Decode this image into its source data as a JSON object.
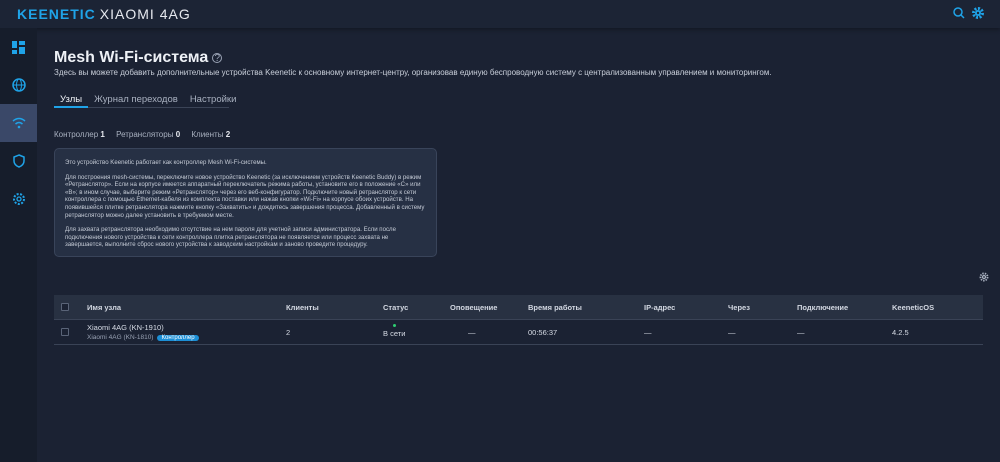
{
  "header": {
    "brand": "KEENETIC",
    "model": "XIAOMI 4AG"
  },
  "page": {
    "title": "Mesh Wi-Fi-система",
    "description": "Здесь вы можете добавить дополнительные устройства Keenetic к основному интернет-центру, организовав единую беспроводную систему с централизованным управлением и мониторингом.",
    "tabs": [
      {
        "label": "Узлы"
      },
      {
        "label": "Журнал переходов"
      },
      {
        "label": "Настройки"
      }
    ],
    "counters": [
      {
        "label": "Контроллер",
        "value": "1"
      },
      {
        "label": "Ретрансляторы",
        "value": "0"
      },
      {
        "label": "Клиенты",
        "value": "2"
      }
    ],
    "info": [
      "Это устройство Keenetic работает как контроллер Mesh Wi-Fi-системы.",
      "Для построения mesh-системы, переключите новое устройство Keenetic (за исключением устройств Keenetic Buddy) в режим «Ретранслятор». Если на корпусе имеется аппаратный переключатель режима работы, установите его в положение «C» или «B»; в ином случае, выберите режим «Ретранслятор» через его веб-конфигуратор. Подключите новый ретранслятор к сети контроллера с помощью Ethernet-кабеля из комплекта поставки или нажав кнопки «Wi-Fi» на корпусе обоих устройств. На появившейся плитке ретранслятора нажмите кнопку «Захватить» и дождитесь завершения процесса. Добавленный в систему ретранслятор можно далее установить в требуемом месте.",
      "Для захвата ретранслятора необходимо отсутствие на нем пароля для учетной записи администратора. Если после подключения нового устройства к сети контроллера плитка ретранслятора не появляется или процесс захвата не завершается, выполните сброс нового устройства к заводским настройкам и заново проведите процедуру."
    ]
  },
  "table": {
    "columns": [
      "Имя узла",
      "Клиенты",
      "Статус",
      "Оповещение",
      "Время работы",
      "IP-адрес",
      "Через",
      "Подключение",
      "KeeneticOS"
    ],
    "rows": [
      {
        "name": "Xiaomi 4AG (KN-1910)",
        "model": "Xiaomi 4AG (KN-1810)",
        "badge": "Контроллер",
        "clients": "2",
        "status": "В сети",
        "notification": "—",
        "uptime": "00:56:37",
        "ip": "—",
        "via": "—",
        "connection": "—",
        "os": "4.2.5"
      }
    ]
  },
  "colors": {
    "accent": "#1fa3e8",
    "online": "#2ecc71"
  }
}
